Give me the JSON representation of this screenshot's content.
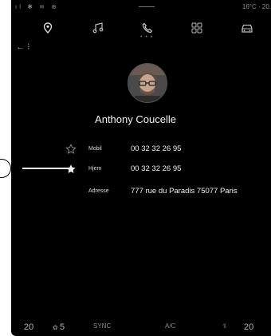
{
  "status_bar": {
    "left_icons": "ıl ✱ ≋ ⊕",
    "temperature": "16°C · 20."
  },
  "nav": {
    "icons": [
      "location-icon",
      "music-icon",
      "phone-icon",
      "apps-icon",
      "car-icon"
    ],
    "dots": "• • •",
    "back_label": "← ⁝"
  },
  "contact": {
    "name": "Anthony Coucelle",
    "rows": [
      {
        "label": "Mobil",
        "value": "00 32 32 26 95",
        "favorite": false
      },
      {
        "label": "Hjem",
        "value": "00 32 32 26 95",
        "favorite": true
      },
      {
        "label": "Adresse",
        "value": "777 rue du Paradis 75077 Paris",
        "favorite": null
      }
    ]
  },
  "bottom_bar": {
    "left_temp": "20",
    "left_fan": "5",
    "sync": "SYNC",
    "ac": "A/C",
    "right_temp": "20"
  },
  "colors": {
    "background": "#000000",
    "text": "#f0f0f0",
    "muted": "#8a8a8a"
  }
}
